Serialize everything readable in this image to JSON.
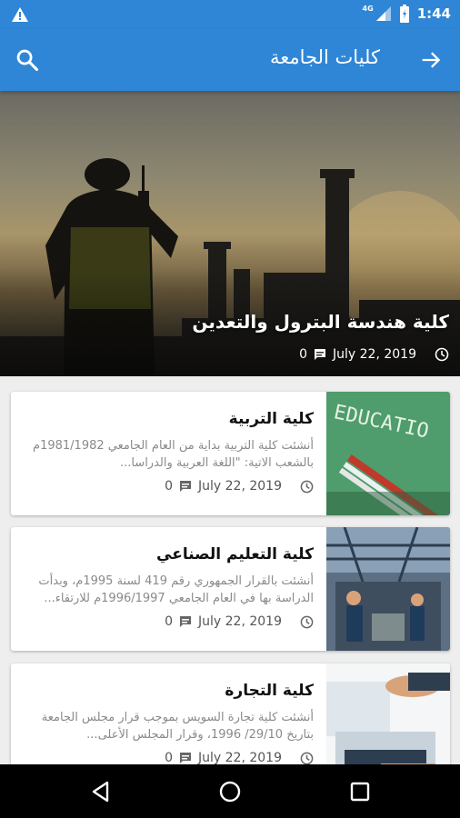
{
  "status_bar": {
    "network": "4G",
    "time": "1:44",
    "icons": [
      "warning-icon",
      "signal-icon",
      "battery-icon"
    ]
  },
  "app_bar": {
    "title": "كليات الجامعة",
    "back_icon": "arrow-right-icon",
    "search_icon": "search-icon",
    "color": "#2f86d6"
  },
  "hero": {
    "title": "كلية هندسة البترول والتعدين",
    "date": "July 22, 2019",
    "comments": "0"
  },
  "articles": [
    {
      "title": "كلية التربية",
      "excerpt": "أنشئت كلية التربية بداية من العام الجامعي 1981/1982م بالشعب الاتية: \"اللغة العربية والدراسا...",
      "date": "July 22, 2019",
      "comments": "0",
      "thumb": "education-chalkboard-image"
    },
    {
      "title": "كلية التعليم الصناعي",
      "excerpt": "أنشئت بالقرار الجمهوري رقم 419 لسنة 1995م، وبدأت الدراسة بها في العام الجامعي 1996/1997م للارتقاء...",
      "date": "July 22, 2019",
      "comments": "0",
      "thumb": "factory-workers-image"
    },
    {
      "title": "كلية التجارة",
      "excerpt": "أنشئت كلية تجارة السويس بموجب قرار مجلس الجامعة بتاريخ 29/10/ 1996، وقرار المجلس الأعلى...",
      "date": "July 22, 2019",
      "comments": "0",
      "thumb": "business-laptop-image"
    }
  ],
  "nav_bar": {
    "buttons": [
      "back-triangle-icon",
      "home-circle-icon",
      "recents-square-icon"
    ]
  }
}
